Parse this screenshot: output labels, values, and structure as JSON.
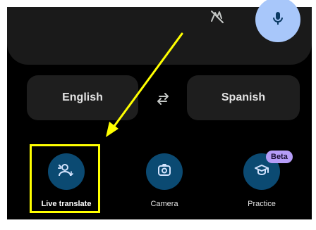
{
  "languages": {
    "source": "English",
    "target": "Spanish"
  },
  "icons": {
    "handwriting": "handwriting-icon",
    "mic": "mic-icon",
    "swap": "swap-arrows-icon",
    "live_translate": "live-translate-icon",
    "camera": "camera-icon",
    "practice": "practice-icon"
  },
  "modes": {
    "live_translate": {
      "label": "Live translate",
      "selected": true
    },
    "camera": {
      "label": "Camera"
    },
    "practice": {
      "label": "Practice",
      "badge": "Beta"
    }
  },
  "colors": {
    "background": "#000000",
    "panel": "#1a1a1a",
    "mic_button": "#a8c7fa",
    "mode_circle": "#0b4a72",
    "beta_badge": "#b69df8",
    "annotation": "#ffff00"
  }
}
